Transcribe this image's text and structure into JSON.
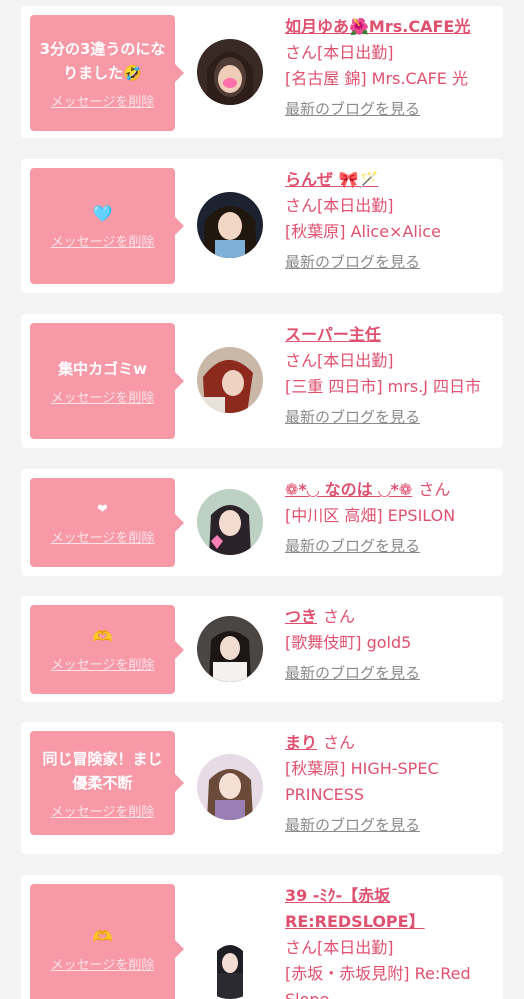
{
  "common": {
    "delete_label": "メッセージを削除",
    "blog_label": "最新のブログを見る",
    "san": "さん"
  },
  "cards": [
    {
      "message": "3分の3違うのになりました🤣",
      "name": "如月ゆあ🌺Mrs.CAFE光",
      "line2": "さん[本日出勤]",
      "line3": "[名古屋 錦] Mrs.CAFE 光"
    },
    {
      "message": "🩵",
      "name": "らんぜ 🎀🪄",
      "line2": "さん[本日出勤]",
      "line3": "[秋葉原] Alice×Alice"
    },
    {
      "message": "集中カゴミw",
      "name": "スーパー主任",
      "line2": "さん[本日出勤]",
      "line3": "[三重 四日市] mrs.J 四日市"
    },
    {
      "message": "❤",
      "name": "❁*◡ なのは ◡*❁",
      "line2": "さん",
      "line3": "[中川区 高畑] EPSILON"
    },
    {
      "message": "🫶",
      "name": "つき",
      "line2": "さん",
      "line3": "[歌舞伎町] gold5"
    },
    {
      "message": "同じ冒険家！まじ優柔不断",
      "name": "まり",
      "line2": "さん",
      "line3": "[秋葉原] HIGH-SPEC PRINCESS"
    },
    {
      "message": "🫶",
      "name": "39 -ﾐｸ-【赤坂RE:REDSLOPE】",
      "line2": "さん[本日出勤]",
      "line3": "[赤坂・赤坂見附] Re:Red Slope"
    }
  ],
  "colors": {
    "bubble": "#f899a8",
    "accent": "#e0506f",
    "link_gray": "#8a8a8a",
    "background": "#f3f3f4"
  }
}
